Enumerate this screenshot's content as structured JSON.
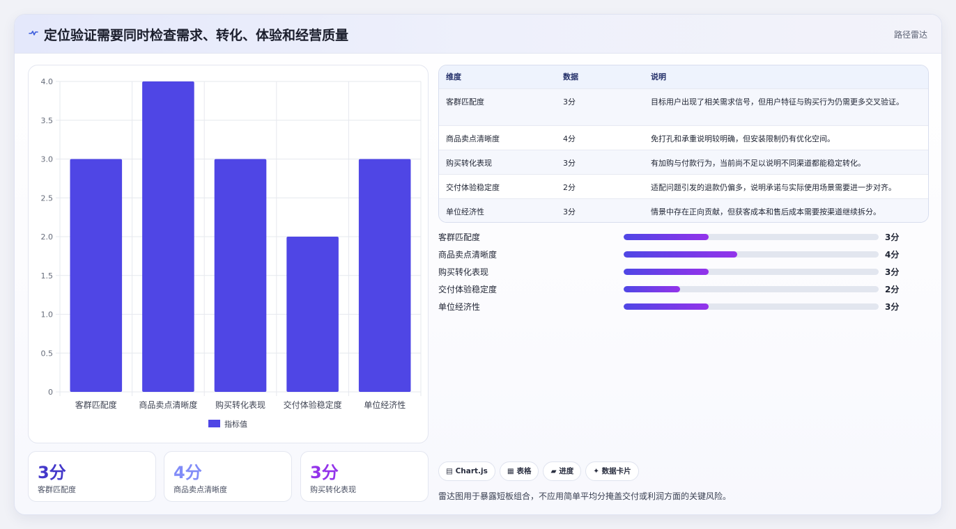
{
  "header": {
    "title": "定位验证需要同时检查需求、转化、体验和经营质量",
    "tag": "路径雷达",
    "icon": "pulse-icon"
  },
  "chart_data": {
    "type": "bar",
    "categories": [
      "客群匹配度",
      "商品卖点清晰度",
      "购买转化表现",
      "交付体验稳定度",
      "单位经济性"
    ],
    "series": [
      {
        "name": "指标值",
        "values": [
          3,
          4,
          3,
          2,
          3
        ]
      }
    ],
    "ylim": [
      0,
      4
    ],
    "yticks": [
      "0",
      "0.5",
      "1.0",
      "1.5",
      "2.0",
      "2.5",
      "3.0",
      "3.5",
      "4.0"
    ],
    "legend": "bottom",
    "grid": true,
    "bar_color": "#4f46e5"
  },
  "stats": [
    {
      "value": "3分",
      "label": "客群匹配度",
      "color": "#4338ca"
    },
    {
      "value": "4分",
      "label": "商品卖点清晰度",
      "color": "#818cf8"
    },
    {
      "value": "3分",
      "label": "购买转化表现",
      "color": "#9333ea"
    }
  ],
  "table": {
    "headers": [
      "维度",
      "数据",
      "说明"
    ],
    "rows": [
      [
        "客群匹配度",
        "3分",
        "目标用户出现了相关需求信号，但用户特征与购买行为仍需更多交叉验证。"
      ],
      [
        "商品卖点清晰度",
        "4分",
        "免打孔和承重说明较明确，但安装限制仍有优化空间。"
      ],
      [
        "购买转化表现",
        "3分",
        "有加购与付款行为，当前尚不足以说明不同渠道都能稳定转化。"
      ],
      [
        "交付体验稳定度",
        "2分",
        "适配问题引发的退款仍偏多，说明承诺与实际使用场景需要进一步对齐。"
      ],
      [
        "单位经济性",
        "3分",
        "情景中存在正向贡献，但获客成本和售后成本需要按渠道继续拆分。"
      ]
    ]
  },
  "progress": [
    {
      "label": "客群匹配度",
      "value": "3分",
      "score": 3,
      "max": 9
    },
    {
      "label": "商品卖点清晰度",
      "value": "4分",
      "score": 4,
      "max": 9
    },
    {
      "label": "购买转化表现",
      "value": "3分",
      "score": 3,
      "max": 9
    },
    {
      "label": "交付体验稳定度",
      "value": "2分",
      "score": 2,
      "max": 9
    },
    {
      "label": "单位经济性",
      "value": "3分",
      "score": 3,
      "max": 9
    }
  ],
  "chips": [
    {
      "label": "▤ Chart.js",
      "icon": "chart-icon"
    },
    {
      "label": "▦ 表格",
      "icon": "table-icon"
    },
    {
      "label": "▰ 进度",
      "icon": "progress-icon"
    },
    {
      "label": "✦ 数据卡片",
      "icon": "sparkle-icon"
    }
  ],
  "note": "雷达图用于暴露短板组合，不应用简单平均分掩盖交付或利润方面的关键风险。"
}
